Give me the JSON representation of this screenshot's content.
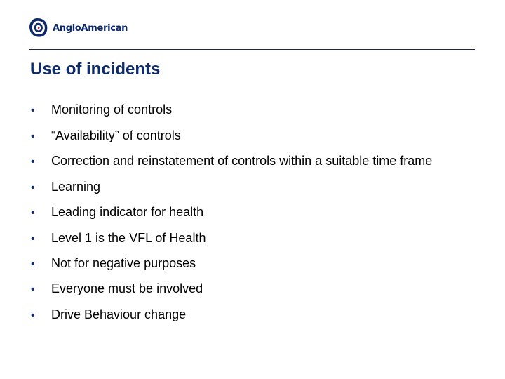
{
  "header": {
    "logo_text": "AngloAmerican",
    "brand_color": "#0d2c6c",
    "accent_color": "#d6203a"
  },
  "slide": {
    "title": "Use of incidents",
    "bullet_glyph": "•",
    "bullets": [
      "Monitoring of controls",
      "“Availability” of controls",
      "Correction and reinstatement of controls within a suitable time frame",
      "Learning",
      "Leading indicator for health",
      "Level 1 is the VFL of Health",
      "Not for negative purposes",
      "Everyone must be involved",
      "Drive Behaviour change"
    ]
  }
}
